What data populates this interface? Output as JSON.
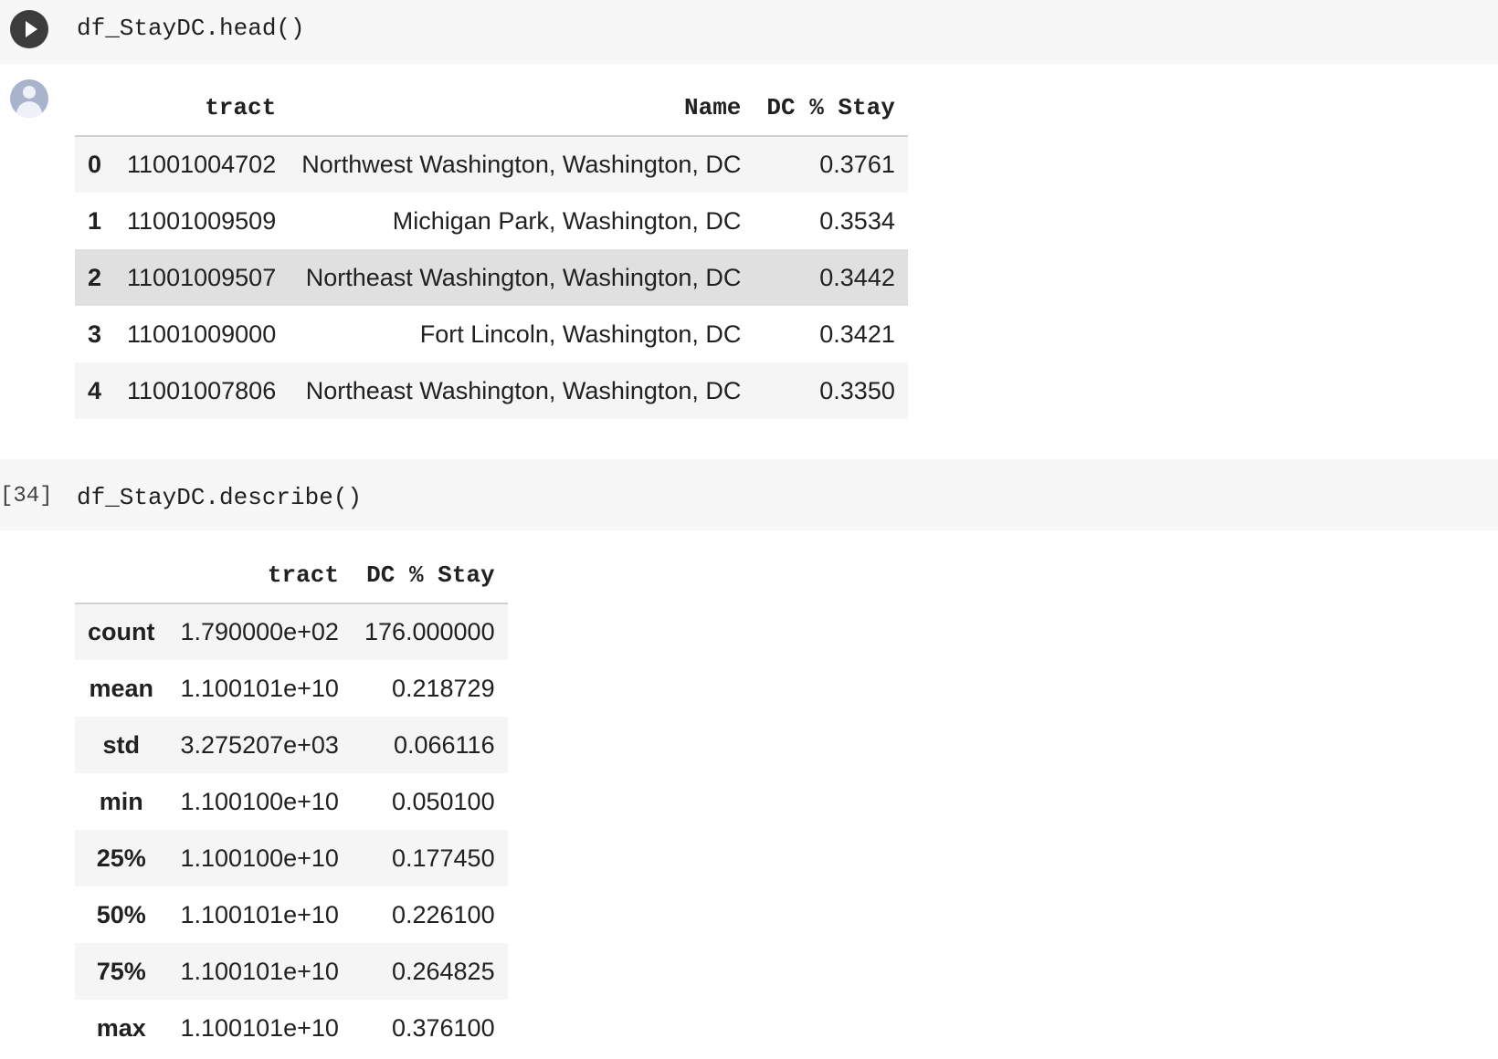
{
  "cell1": {
    "code": "df_StayDC.head()"
  },
  "head_table": {
    "columns": [
      "",
      "tract",
      "Name",
      "DC % Stay"
    ],
    "rows": [
      {
        "index": "0",
        "tract": "11001004702",
        "name": "Northwest Washington, Washington, DC",
        "stay": "0.3761"
      },
      {
        "index": "1",
        "tract": "11001009509",
        "name": "Michigan Park, Washington, DC",
        "stay": "0.3534"
      },
      {
        "index": "2",
        "tract": "11001009507",
        "name": "Northeast Washington, Washington, DC",
        "stay": "0.3442"
      },
      {
        "index": "3",
        "tract": "11001009000",
        "name": "Fort Lincoln, Washington, DC",
        "stay": "0.3421"
      },
      {
        "index": "4",
        "tract": "11001007806",
        "name": "Northeast Washington, Washington, DC",
        "stay": "0.3350"
      }
    ]
  },
  "cell2": {
    "exec_count": "[34]",
    "code": "df_StayDC.describe()"
  },
  "describe_table": {
    "columns": [
      "",
      "tract",
      "DC % Stay"
    ],
    "rows": [
      {
        "stat": "count",
        "tract": "1.790000e+02",
        "stay": "176.000000"
      },
      {
        "stat": "mean",
        "tract": "1.100101e+10",
        "stay": "0.218729"
      },
      {
        "stat": "std",
        "tract": "3.275207e+03",
        "stay": "0.066116"
      },
      {
        "stat": "min",
        "tract": "1.100100e+10",
        "stay": "0.050100"
      },
      {
        "stat": "25%",
        "tract": "1.100100e+10",
        "stay": "0.177450"
      },
      {
        "stat": "50%",
        "tract": "1.100101e+10",
        "stay": "0.226100"
      },
      {
        "stat": "75%",
        "tract": "1.100101e+10",
        "stay": "0.264825"
      },
      {
        "stat": "max",
        "tract": "1.100101e+10",
        "stay": "0.376100"
      }
    ]
  },
  "icons": {
    "run": "play-icon",
    "avatar": "user-avatar-icon"
  },
  "colors": {
    "code_cell_bg": "#f7f7f7",
    "row_stripe": "#f5f5f5",
    "row_hover": "#e0e0e0"
  }
}
